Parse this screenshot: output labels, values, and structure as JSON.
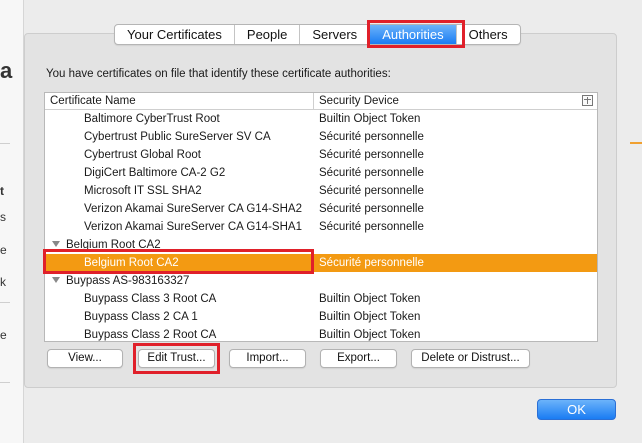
{
  "tabs": [
    {
      "label": "Your Certificates",
      "active": false
    },
    {
      "label": "People",
      "active": false
    },
    {
      "label": "Servers",
      "active": false
    },
    {
      "label": "Authorities",
      "active": true
    },
    {
      "label": "Others",
      "active": false
    }
  ],
  "intro_text": "You have certificates on file that identify these certificate authorities:",
  "table": {
    "headers": {
      "name": "Certificate Name",
      "device": "Security Device"
    },
    "rows": [
      {
        "name": "Baltimore CyberTrust Root",
        "device": "Builtin Object Token"
      },
      {
        "name": "Cybertrust Public SureServer SV CA",
        "device": "Sécurité personnelle"
      },
      {
        "name": "Cybertrust Global Root",
        "device": "Sécurité personnelle"
      },
      {
        "name": "DigiCert Baltimore CA-2 G2",
        "device": "Sécurité personnelle"
      },
      {
        "name": "Microsoft IT SSL SHA2",
        "device": "Sécurité personnelle"
      },
      {
        "name": "Verizon Akamai SureServer CA G14-SHA2",
        "device": "Sécurité personnelle"
      },
      {
        "name": "Verizon Akamai SureServer CA G14-SHA1",
        "device": "Sécurité personnelle"
      },
      {
        "name": "Belgium Root CA2",
        "device": "",
        "group": true
      },
      {
        "name": "Belgium Root CA2",
        "device": "Sécurité personnelle",
        "selected": true
      },
      {
        "name": "Buypass AS-983163327",
        "device": "",
        "group": true
      },
      {
        "name": "Buypass Class 3 Root CA",
        "device": "Builtin Object Token"
      },
      {
        "name": "Buypass Class 2 CA 1",
        "device": "Builtin Object Token"
      },
      {
        "name": "Buypass Class 2 Root CA",
        "device": "Builtin Object Token"
      }
    ]
  },
  "buttons": {
    "view": "View...",
    "edit_trust": "Edit Trust...",
    "import": "Import...",
    "export": "Export...",
    "delete": "Delete or Distrust...",
    "ok": "OK"
  },
  "background_letters": [
    "a",
    "t",
    "s",
    "e",
    "k",
    "e"
  ],
  "colors": {
    "accent": "#1a7cf3",
    "selection": "#f39a12",
    "highlight_box": "#e0202a"
  },
  "icons": {
    "group_toggle": "disclosure-triangle-icon",
    "column_picker": "column-picker-icon"
  }
}
